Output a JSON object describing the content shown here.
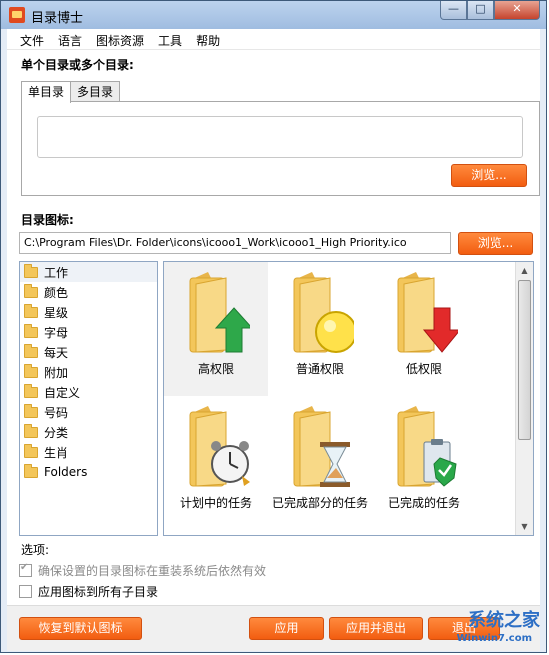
{
  "window": {
    "title": "目录博士",
    "min_glyph": "—",
    "max_glyph": "□",
    "close_glyph": "✕"
  },
  "menu": [
    "文件",
    "语言",
    "图标资源",
    "工具",
    "帮助"
  ],
  "section_dirs": "单个目录或多个目录:",
  "tabs": [
    "单目录",
    "多目录"
  ],
  "browse_label": "浏览...",
  "section_icon": "目录图标:",
  "icon_path": "C:\\Program Files\\Dr. Folder\\icons\\icooo1_Work\\icooo1_High Priority.ico",
  "categories": [
    "工作",
    "颜色",
    "星级",
    "字母",
    "每天",
    "附加",
    "自定义",
    "号码",
    "分类",
    "生肖",
    "Folders"
  ],
  "icons": [
    {
      "label": "高权限",
      "badge": "arrow-up"
    },
    {
      "label": "普通权限",
      "badge": "circle"
    },
    {
      "label": "低权限",
      "badge": "arrow-down"
    },
    {
      "label": "计划中的任务",
      "badge": "alarm-clock"
    },
    {
      "label": "已完成部分的任务",
      "badge": "hourglass"
    },
    {
      "label": "已完成的任务",
      "badge": "clipboard-check"
    }
  ],
  "options_label": "选项:",
  "option_persist": "确保设置的目录图标在重装系统后依然有效",
  "option_subdirs": "应用图标到所有子目录",
  "buttons": {
    "restore": "恢复到默认图标",
    "apply": "应用",
    "apply_exit": "应用并退出",
    "exit": "退出"
  },
  "watermark": {
    "text": "系统之家",
    "url": "Winwin7.com"
  },
  "colors": {
    "accent_orange": "#f25d10",
    "folder_yellow": "#f3c65a"
  }
}
